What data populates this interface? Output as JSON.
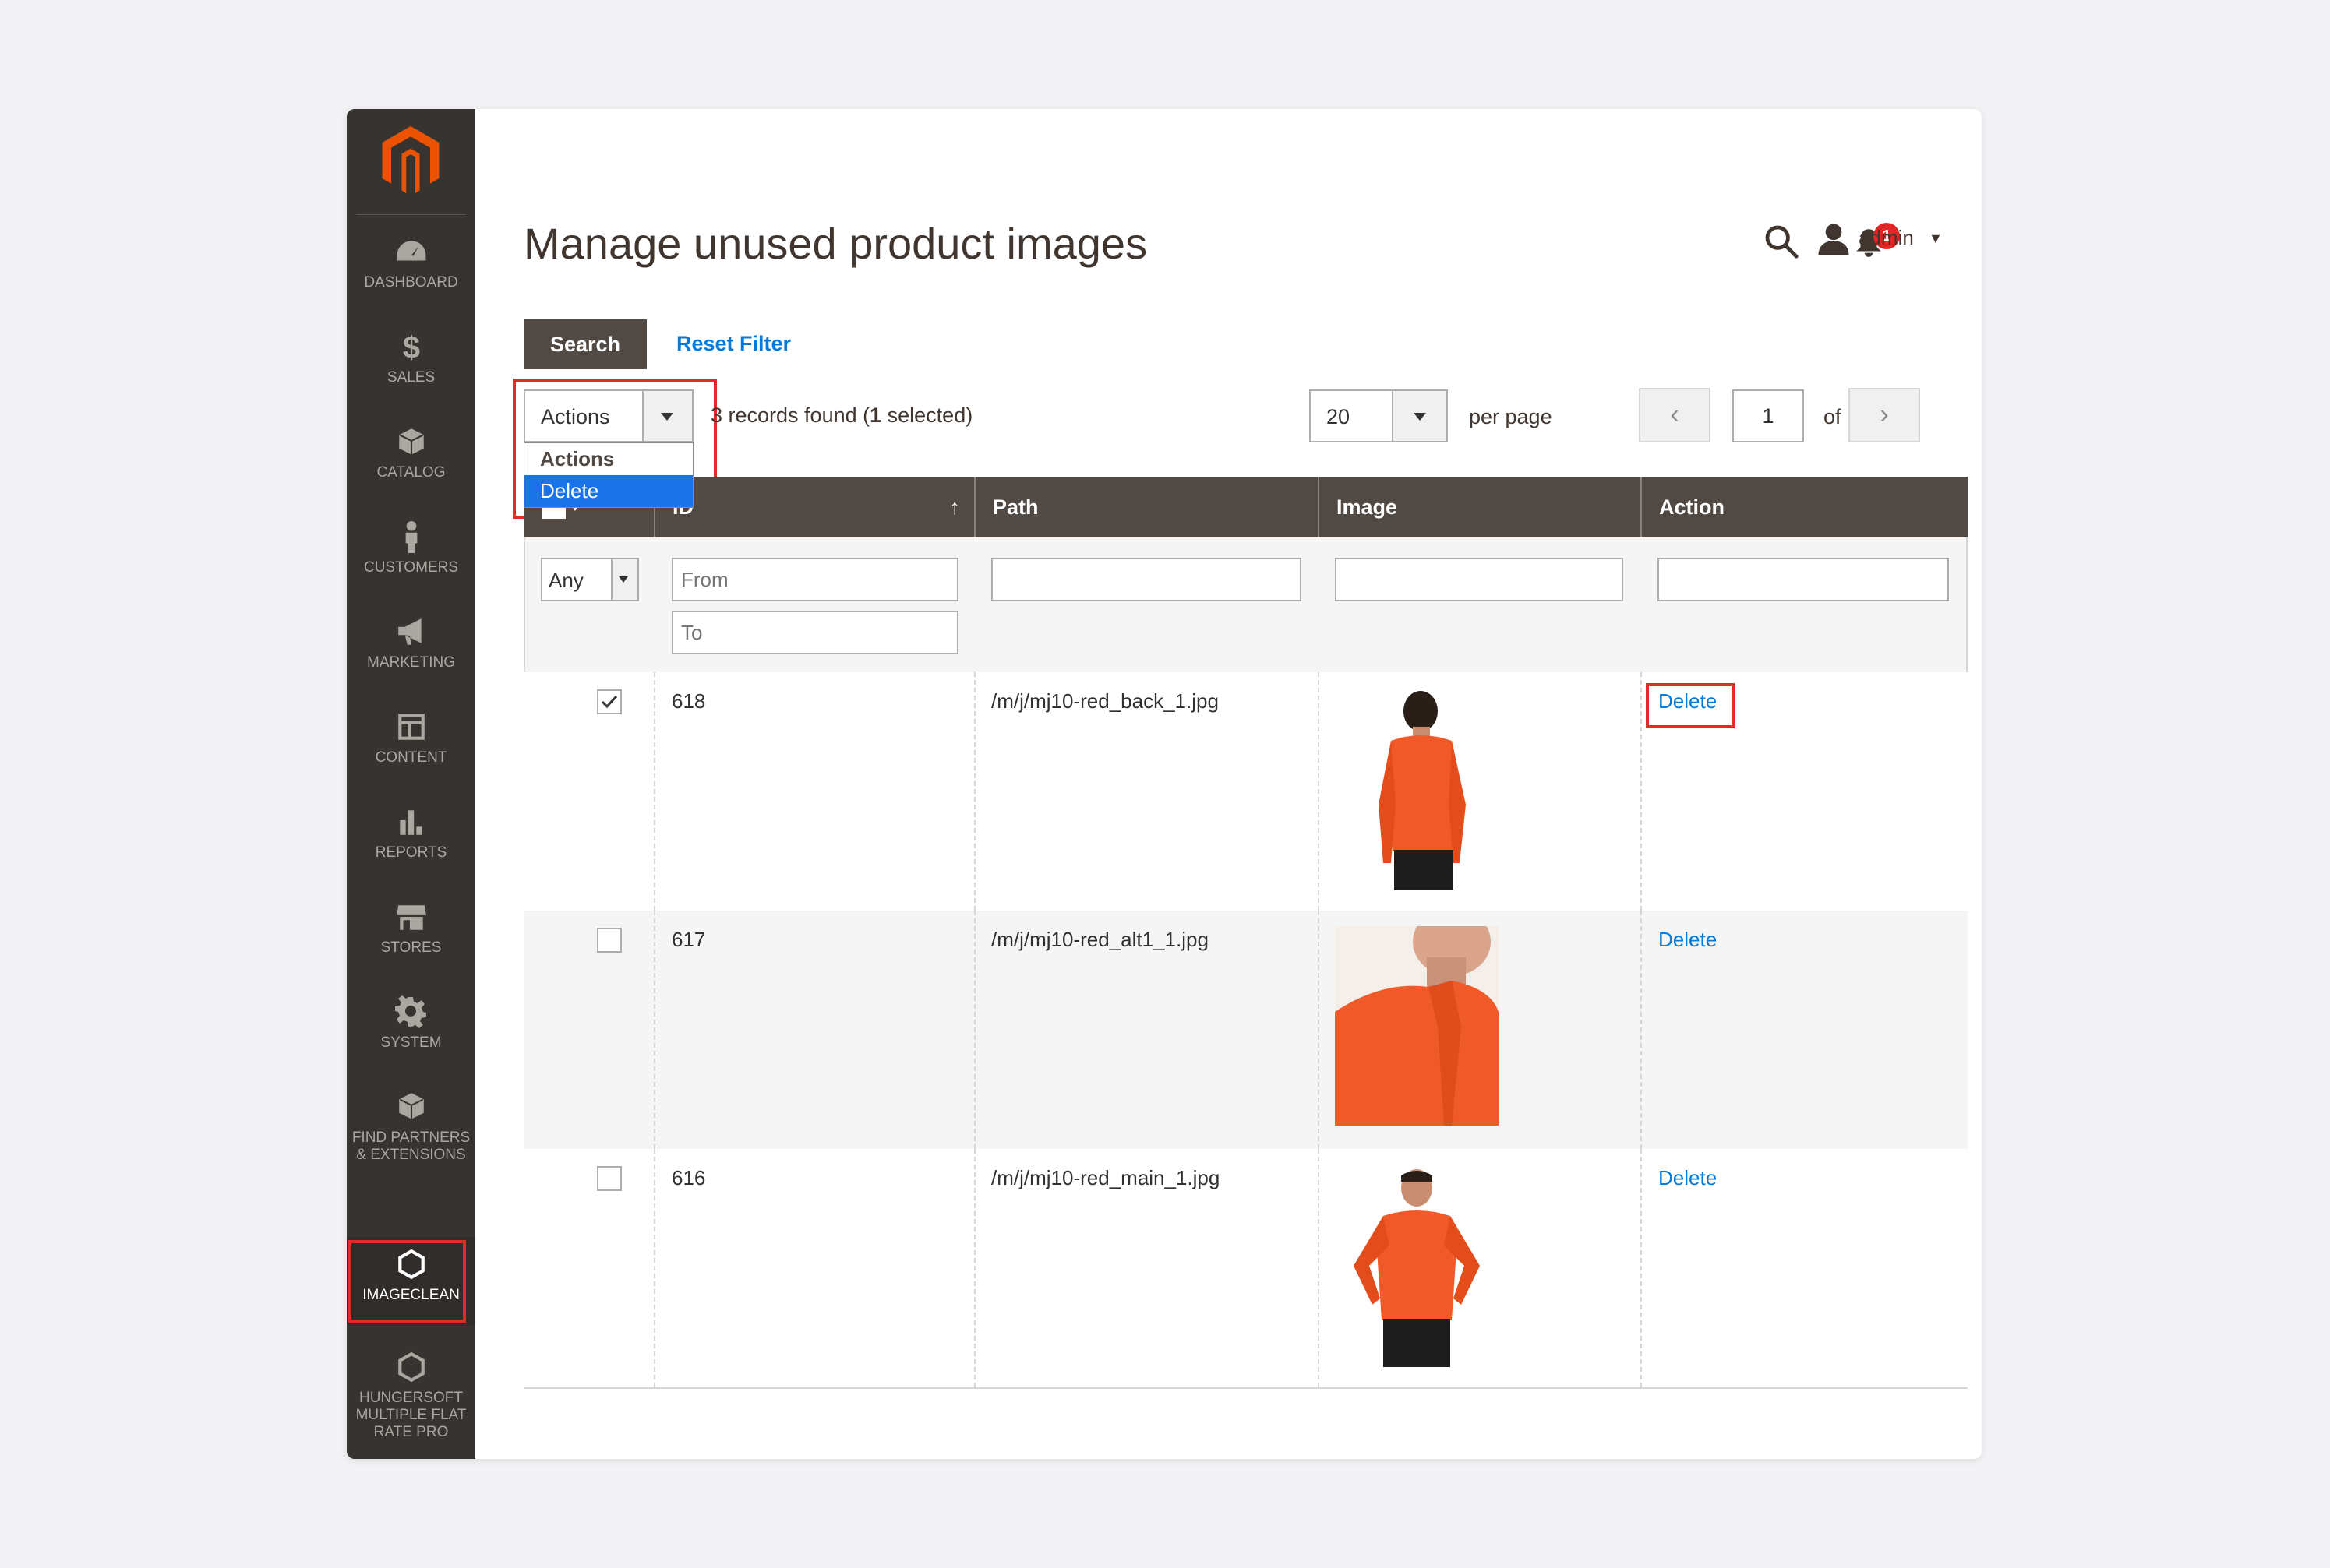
{
  "colors": {
    "sidebar_bg": "#373330",
    "accent_orange": "#eb5202",
    "link_blue": "#007bdb",
    "header_dark": "#514943",
    "highlight_red": "#e02b27",
    "selected_blue": "#1a73e8",
    "shirt_orange": "#f05a28"
  },
  "sidebar": {
    "logo_icon": "magento-logo-icon",
    "items": [
      {
        "label": "DASHBOARD",
        "icon": "dashboard-icon"
      },
      {
        "label": "SALES",
        "icon": "dollar-icon"
      },
      {
        "label": "CATALOG",
        "icon": "box-icon"
      },
      {
        "label": "CUSTOMERS",
        "icon": "person-icon"
      },
      {
        "label": "MARKETING",
        "icon": "megaphone-icon"
      },
      {
        "label": "CONTENT",
        "icon": "layout-icon"
      },
      {
        "label": "REPORTS",
        "icon": "bar-chart-icon"
      },
      {
        "label": "STORES",
        "icon": "store-icon"
      },
      {
        "label": "SYSTEM",
        "icon": "gear-icon"
      },
      {
        "label": "FIND PARTNERS & EXTENSIONS",
        "icon": "cubes-icon"
      },
      {
        "label": "IMAGECLEAN",
        "icon": "hexagon-icon",
        "active": true
      },
      {
        "label": "HUNGERSOFT MULTIPLE FLAT RATE PRO",
        "icon": "hexagon-icon"
      }
    ]
  },
  "header": {
    "title": "Manage unused product images",
    "notification_count": "1",
    "user_label": "admin",
    "search_icon": "search-icon",
    "bell_icon": "bell-icon",
    "user_icon": "user-icon"
  },
  "toolbar": {
    "search_label": "Search",
    "reset_label": "Reset Filter",
    "actions_value": "Actions",
    "actions_options": [
      "Actions",
      "Delete"
    ],
    "records_prefix": "3 records found (",
    "records_selected": "1",
    "records_suffix": " selected)",
    "per_page_value": "20",
    "per_page_label": "per page",
    "page_value": "1",
    "of_label": "of 1"
  },
  "grid": {
    "columns": [
      "ID",
      "Path",
      "Image",
      "Action"
    ],
    "sort_indicator": "↑",
    "filters": {
      "mass_select": "Any",
      "id_from_placeholder": "From",
      "id_to_placeholder": "To"
    },
    "rows": [
      {
        "checked": true,
        "id": "618",
        "path": "/m/j/mj10-red_back_1.jpg",
        "action": "Delete",
        "image": "orange-shirt-back"
      },
      {
        "checked": false,
        "id": "617",
        "path": "/m/j/mj10-red_alt1_1.jpg",
        "action": "Delete",
        "image": "orange-shirt-closeup"
      },
      {
        "checked": false,
        "id": "616",
        "path": "/m/j/mj10-red_main_1.jpg",
        "action": "Delete",
        "image": "orange-shirt-front"
      }
    ]
  }
}
